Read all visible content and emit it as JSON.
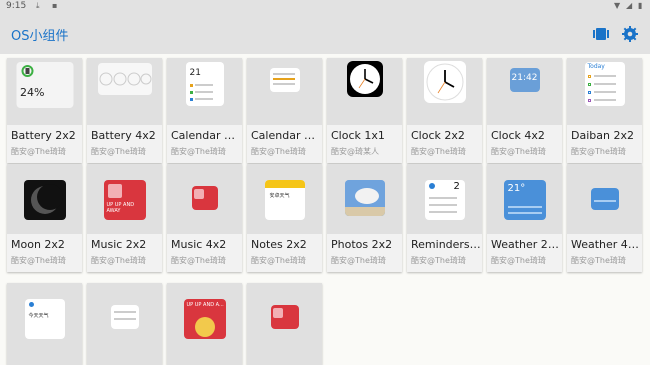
{
  "status": {
    "time": "9:15"
  },
  "app": {
    "title": "OS小组件"
  },
  "cards": [
    {
      "name": "Battery 2x2",
      "author": "酷安@The琦琦",
      "thumb_text": "24%"
    },
    {
      "name": "Battery 4x2",
      "author": "酷安@The琦琦"
    },
    {
      "name": "Calendar 2x2",
      "author": "酷安@The琦琦",
      "thumb_text": "21"
    },
    {
      "name": "Calendar 4x2",
      "author": "酷安@The琦琦"
    },
    {
      "name": "Clock 1x1",
      "author": "酷安@琦某人"
    },
    {
      "name": "Clock 2x2",
      "author": "酷安@The琦琦"
    },
    {
      "name": "Clock 4x2",
      "author": "酷安@The琦琦",
      "thumb_text": "21:42"
    },
    {
      "name": "Daiban 2x2",
      "author": "酷安@The琦琦",
      "thumb_text": "Today"
    },
    {
      "name": "Moon 2x2",
      "author": "酷安@The琦琦"
    },
    {
      "name": "Music 2x2",
      "author": "酷安@The琦琦",
      "thumb_text": "UP UP AND AWAY"
    },
    {
      "name": "Music 4x2",
      "author": "酷安@The琦琦"
    },
    {
      "name": "Notes 2x2",
      "author": "酷安@The琦琦",
      "thumb_text": "安卓天气"
    },
    {
      "name": "Photos 2x2",
      "author": "酷安@The琦琦"
    },
    {
      "name": "Reminders 2x2",
      "author": "酷安@The琦琦",
      "thumb_text": "2"
    },
    {
      "name": "Weather 2x2",
      "author": "酷安@The琦琦",
      "thumb_text": "21°"
    },
    {
      "name": "Weather 4x2",
      "author": "酷安@The琦琦"
    },
    {
      "name": "",
      "author": "",
      "thumb_text": "今天天气"
    },
    {
      "name": "",
      "author": ""
    },
    {
      "name": "",
      "author": "",
      "thumb_text": "UP UP AND A..."
    },
    {
      "name": "",
      "author": ""
    }
  ]
}
